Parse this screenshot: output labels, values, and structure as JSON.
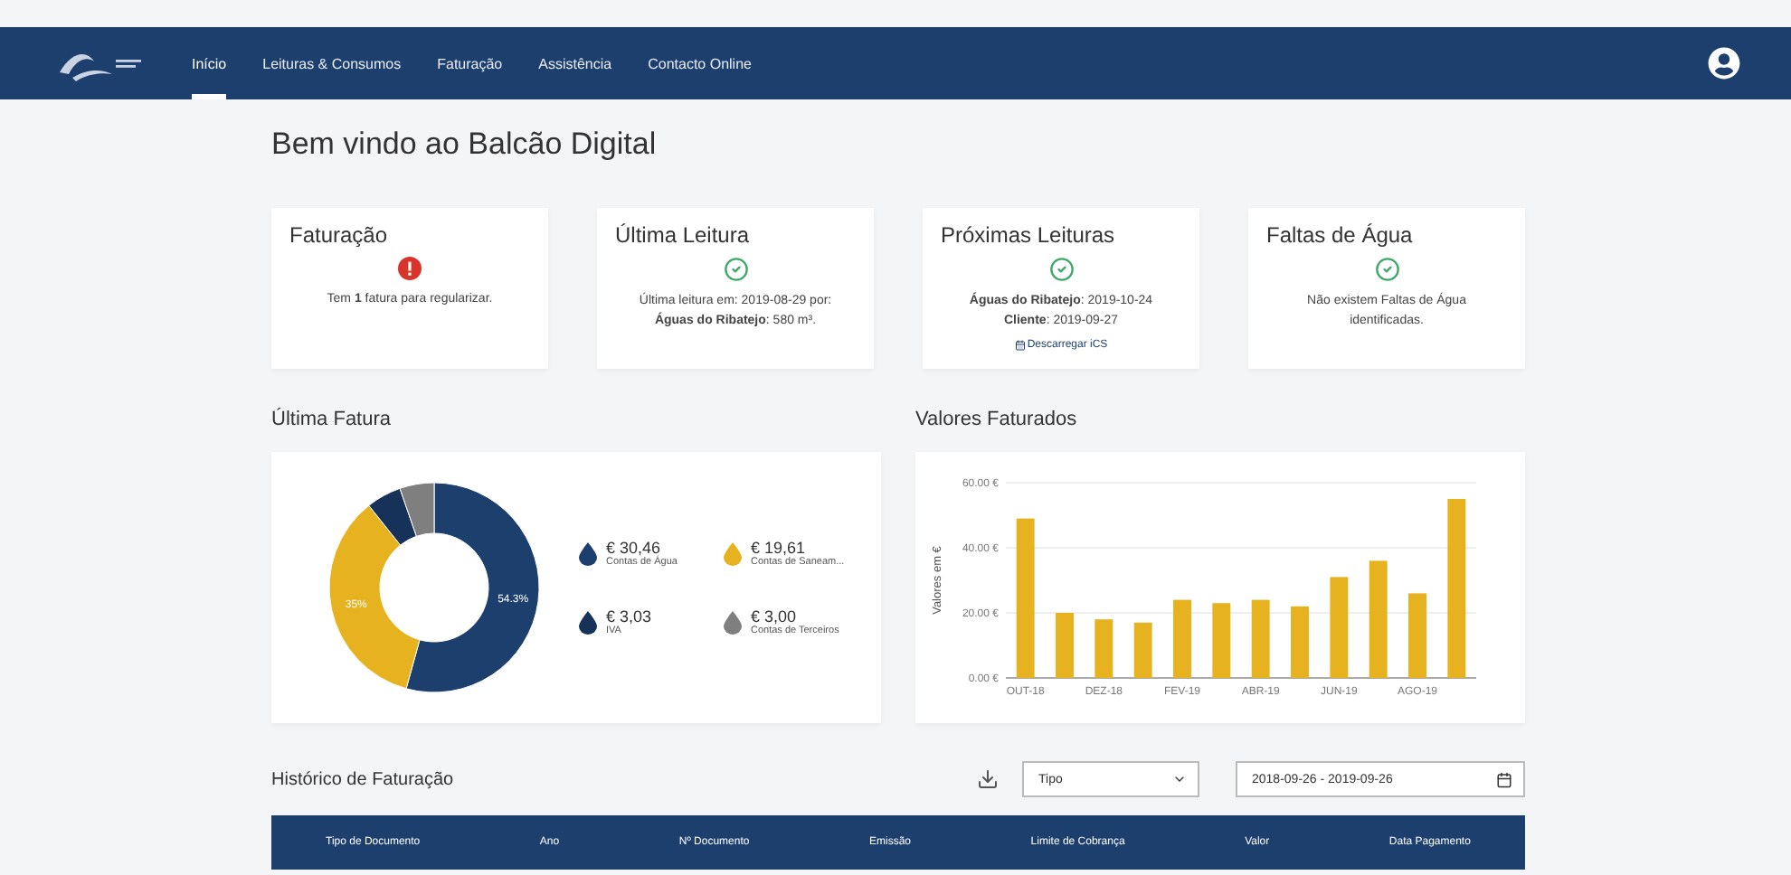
{
  "nav": {
    "items": [
      {
        "label": "Início",
        "selected": true
      },
      {
        "label": "Leituras & Consumos",
        "selected": false
      },
      {
        "label": "Faturação",
        "selected": false
      },
      {
        "label": "Assistência",
        "selected": false
      },
      {
        "label": "Contacto Online",
        "selected": false
      }
    ]
  },
  "welcome": "Bem vindo ao Balcão Digital",
  "cards": [
    {
      "title": "Faturação",
      "kind": "alert",
      "lines": [
        "Tem **1** fatura para regularizar."
      ]
    },
    {
      "title": "Última Leitura",
      "kind": "ok",
      "lines": [
        "Última leitura em: 2019-08-29 por:",
        "**Águas do Ribatejo**: 580 m³."
      ]
    },
    {
      "title": "Próximas Leituras",
      "kind": "ok",
      "lines": [
        "**Águas do Ribatejo**: 2019-10-24",
        "**Cliente**: 2019-09-27"
      ],
      "link": "Descarregar iCS"
    },
    {
      "title": "Faltas de Água",
      "kind": "ok",
      "lines": [
        "Não existem Faltas de Água identificadas."
      ]
    }
  ],
  "last_invoice": {
    "title": "Última Fatura",
    "chart_data": {
      "type": "donut",
      "values": [
        54.3,
        35,
        5.4,
        5.3
      ],
      "colors": [
        "#1d3f6e",
        "#e6b21f",
        "#173258",
        "#7f7f7f"
      ],
      "value_labels": [
        "54.3%",
        "35%",
        null,
        null
      ]
    },
    "legend": [
      {
        "amount": "€ 30,46",
        "label": "Contas de Água",
        "color": "#1d3f6e"
      },
      {
        "amount": "€ 19,61",
        "label": "Contas de Saneam...",
        "color": "#e6b21f"
      },
      {
        "amount": "€ 3,03",
        "label": "IVA",
        "color": "#173258"
      },
      {
        "amount": "€ 3,00",
        "label": "Contas de Terceiros",
        "color": "#7f7f7f"
      }
    ]
  },
  "billed_values": {
    "title": "Valores Faturados",
    "chart_data": {
      "type": "bar",
      "ylabel": "Valores em €",
      "yticks": [
        {
          "value": 0,
          "label": "0.00 €"
        },
        {
          "value": 20,
          "label": "20.00 €"
        },
        {
          "value": 40,
          "label": "40.00 €"
        },
        {
          "value": 60,
          "label": "60.00 €"
        }
      ],
      "categories": [
        "OUT-18",
        null,
        "DEZ-18",
        null,
        "FEV-19",
        null,
        "ABR-19",
        null,
        "JUN-19",
        null,
        "AGO-19",
        null
      ],
      "series": [
        {
          "color": "#e6b21f",
          "values": [
            49,
            20,
            18,
            17,
            24,
            23,
            24,
            22,
            31,
            36,
            26,
            55
          ]
        }
      ],
      "ylim": [
        0,
        60
      ]
    }
  },
  "history": {
    "title": "Histórico de Faturação",
    "type_select": {
      "value": "Tipo"
    },
    "date_range": {
      "value": "2018-09-26 - 2019-09-26"
    },
    "table": {
      "columns": [
        "Tipo de Documento",
        "Ano",
        "Nº Documento",
        "Emissão",
        "Limite de Cobrança",
        "Valor",
        "Data Pagamento"
      ]
    }
  }
}
